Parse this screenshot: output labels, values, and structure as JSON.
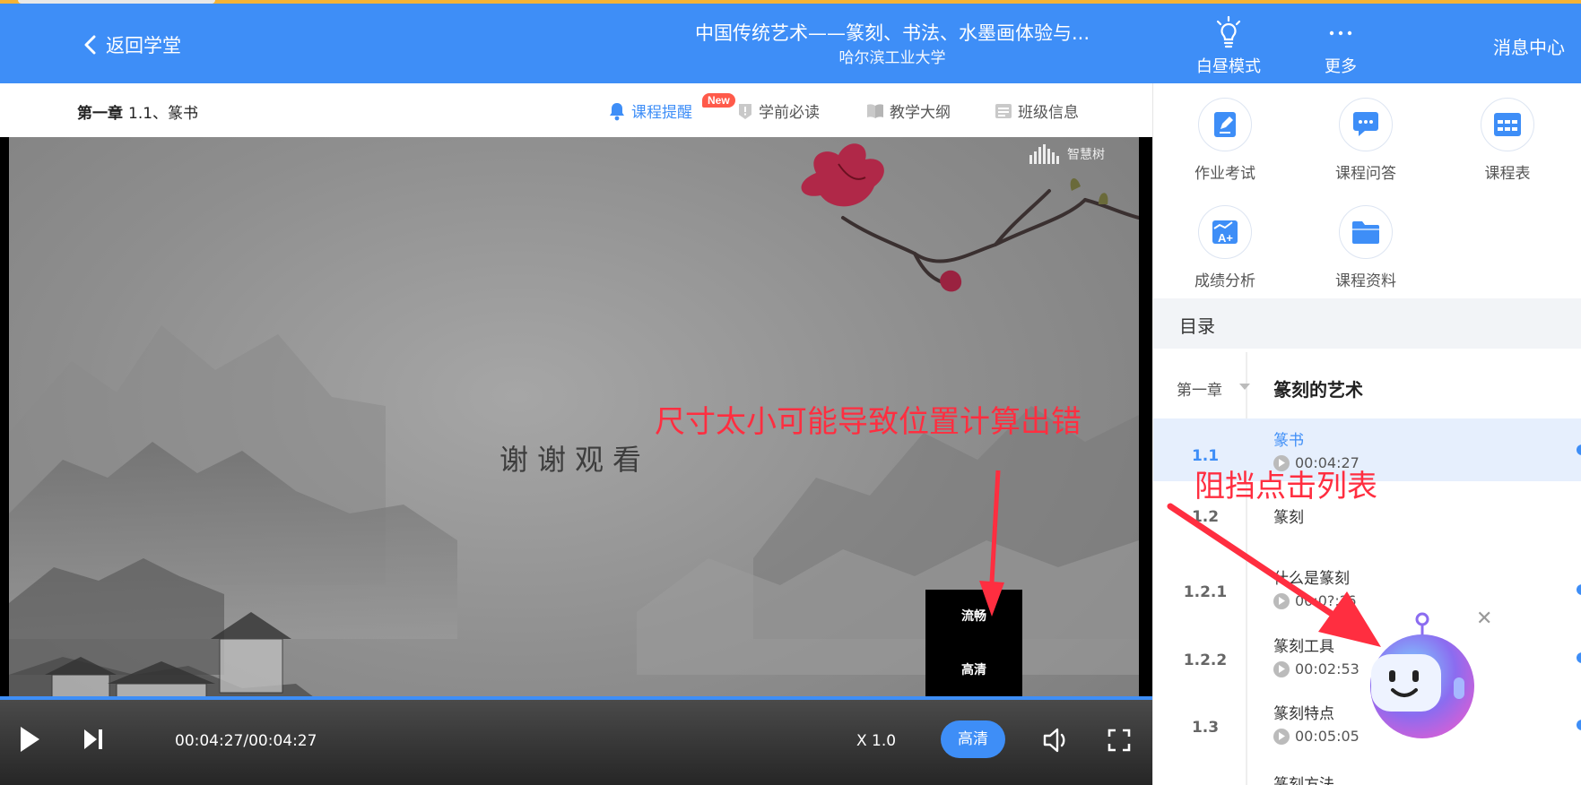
{
  "header": {
    "back_label": "返回学堂",
    "course_title": "中国传统艺术——篆刻、书法、水墨画体验与...",
    "school": "哈尔滨工业大学",
    "day_mode_label": "白昼模式",
    "more_label": "更多",
    "message_center_label": "消息中心"
  },
  "subnav": {
    "chapter_label": "第一章",
    "lesson_label": "1.1、篆书",
    "items": [
      {
        "label": "课程提醒"
      },
      {
        "label": "学前必读"
      },
      {
        "label": "教学大纲"
      },
      {
        "label": "班级信息"
      }
    ],
    "new_badge": "New"
  },
  "player": {
    "watermark": "智慧树",
    "overlay_text": "谢谢观看",
    "quality_options": [
      "流畅",
      "高清"
    ],
    "progress": 1.0,
    "time": "00:04:27/00:04:27",
    "speed": "X 1.0",
    "quality_current": "高清"
  },
  "annotations": {
    "video_note": "尺寸太小可能导致位置计算出错",
    "list_note": "阻挡点击列表"
  },
  "tools": [
    {
      "label": "作业考试",
      "icon": "edit-doc-icon"
    },
    {
      "label": "课程问答",
      "icon": "chat-icon"
    },
    {
      "label": "课程表",
      "icon": "timetable-icon"
    },
    {
      "label": "成绩分析",
      "icon": "grade-icon"
    },
    {
      "label": "课程资料",
      "icon": "folder-icon"
    }
  ],
  "catalog": {
    "title": "目录",
    "chapter_no": "第一章",
    "chapter_title": "篆刻的艺术",
    "lessons": [
      {
        "no": "1.1",
        "title": "篆书",
        "time": "00:04:27"
      },
      {
        "no": "1.2",
        "title": "篆刻",
        "time": ""
      },
      {
        "no": "1.2.1",
        "title": "什么是篆刻",
        "time": "00:0?:?6"
      },
      {
        "no": "1.2.2",
        "title": "篆刻工具",
        "time": "00:02:53"
      },
      {
        "no": "1.3",
        "title": "篆刻特点",
        "time": "00:05:05"
      },
      {
        "no": "",
        "title": "篆刻方法",
        "time": ""
      }
    ]
  },
  "colors": {
    "primary": "#3e8ef7",
    "annotation": "#ff2e40",
    "top_accent": "#f5b335"
  }
}
